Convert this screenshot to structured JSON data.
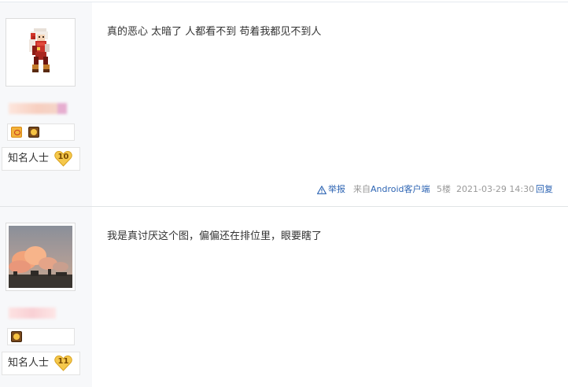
{
  "posts": [
    {
      "content": "真的恶心 太暗了 人都看不到 苟着我都见不到人",
      "level_title": "知名人士",
      "level_num": "10",
      "footer": {
        "report": "举报",
        "source_prefix": "来自",
        "source_device": "Android客户端",
        "floor": "5楼",
        "time": "2021-03-29 14:30",
        "reply": "回复"
      }
    },
    {
      "content": "我是真讨厌这个图，偏偏还在排位里，眼要瞎了",
      "level_title": "知名人士",
      "level_num": "11"
    }
  ],
  "colors": {
    "link": "#2d64b3",
    "meta": "#999999",
    "sidebar_bg": "#f7f8fa",
    "level_heart": "#f5c84c"
  },
  "icons": [
    "warning-icon",
    "heart-level-icon",
    "badge-icon"
  ]
}
